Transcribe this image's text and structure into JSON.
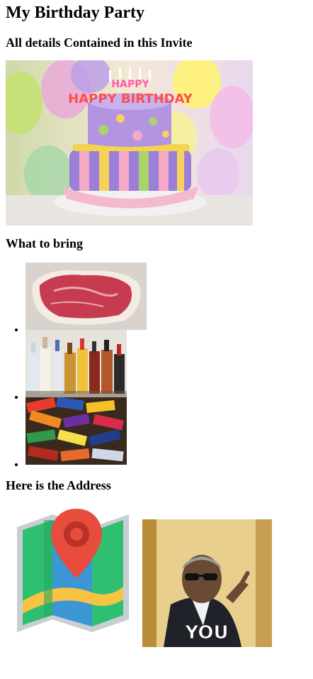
{
  "page": {
    "title": "My Birthday Party",
    "subtitle": "All details Contained in this Invite",
    "bring_heading": "What to bring",
    "address_heading": "Here is the Address"
  },
  "images": {
    "cake": {
      "caption": "HAPPY BIRTHDAY"
    },
    "gif": {
      "caption": "YOU"
    }
  },
  "bring_items": [
    {
      "name": "steak"
    },
    {
      "name": "alcohol bottles"
    },
    {
      "name": "candy bars"
    }
  ],
  "colors": {
    "map_green": "#2fbf71",
    "map_blue": "#3b97d3",
    "map_yellow": "#f6c344",
    "pin_red": "#e74c3c"
  }
}
